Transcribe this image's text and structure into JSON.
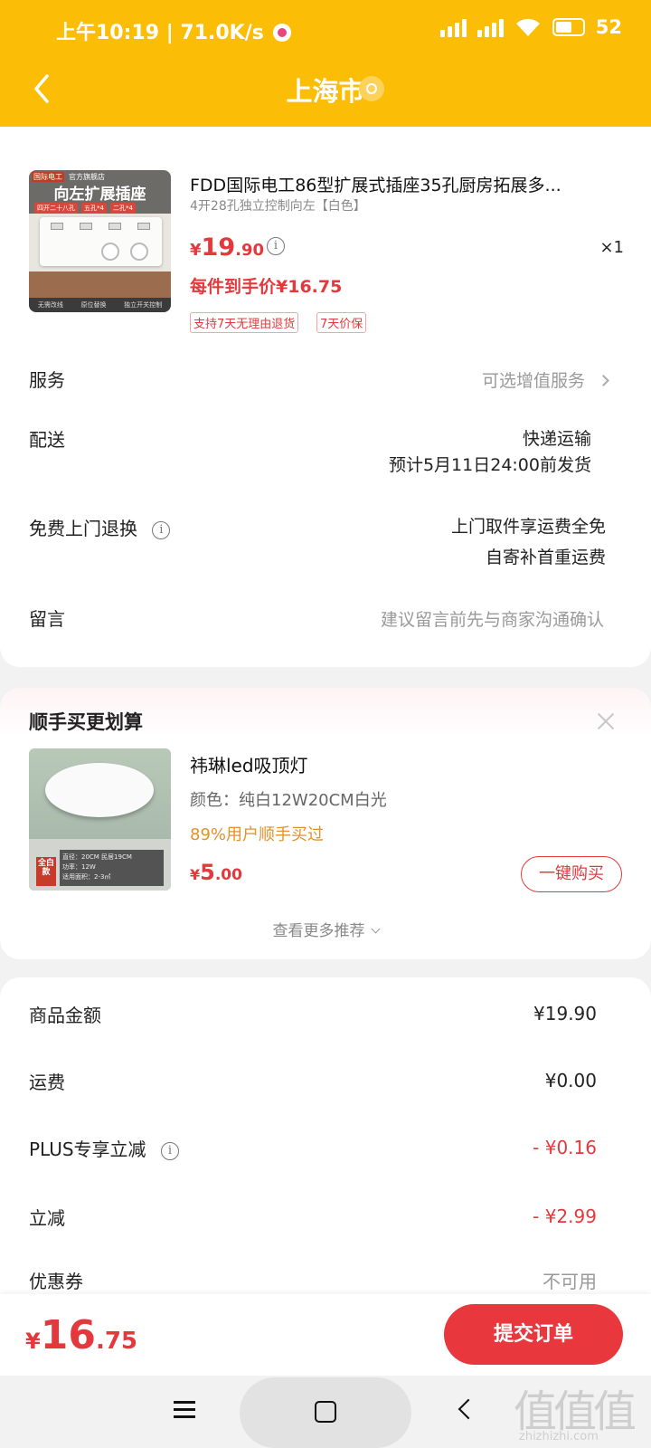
{
  "status_bar": {
    "time": "上午10:19",
    "net_speed": "71.0K/s",
    "battery": "52"
  },
  "nav": {
    "title": "上海市",
    "back_icon": "chevron-left-icon",
    "location_icon": "location-pin-icon"
  },
  "product": {
    "image_labels": {
      "badge1": "国际电工",
      "badge2": "官方旗舰店",
      "headline": "向左扩展插座",
      "chip1": "四开二十八孔",
      "chip2": "五孔*4",
      "chip3": "二孔*4",
      "foot1": "无需改线",
      "foot2": "原位替换",
      "foot3": "独立开关控制"
    },
    "title": "FDD国际电工86型扩展式插座35孔厨房拓展多...",
    "spec": "4开28孔独立控制向左【白色】",
    "price_currency": "¥",
    "price_int": "19",
    "price_dec": ".90",
    "quantity": "×1",
    "hand_price": "每件到手价¥16.75",
    "badges": [
      "支持7天无理由退货",
      "7天价保"
    ]
  },
  "rows": {
    "service_label": "服务",
    "service_value": "可选增值服务",
    "delivery_label": "配送",
    "delivery_value1": "快递运输",
    "delivery_value2": "预计5月11日24:00前发货",
    "return_label": "免费上门退换",
    "return_value1": "上门取件享运费全免",
    "return_value2": "自寄补首重运费",
    "message_label": "留言",
    "message_placeholder": "建议留言前先与商家沟通确认"
  },
  "recommend": {
    "title": "顺手买更划算",
    "image_labels": {
      "badge": "全白款",
      "spec1": "直径：20CM  民居19CM",
      "spec2": "功率：12W",
      "spec3": "适用面积：2-3㎡"
    },
    "item_title": "祎琳led吸顶灯",
    "item_spec": "颜色：纯白12W20CM白光",
    "item_bought": "89%用户顺手买过",
    "price_currency": "¥",
    "price_int": "5",
    "price_dec": ".00",
    "buy_label": "一键购买",
    "more_label": "查看更多推荐"
  },
  "amounts": {
    "goods_label": "商品金额",
    "goods_value": "¥19.90",
    "shipping_label": "运费",
    "shipping_value": "¥0.00",
    "plus_label": "PLUS专享立减",
    "plus_value": "- ¥0.16",
    "discount_label": "立减",
    "discount_value": "- ¥2.99",
    "coupon_label": "优惠券",
    "coupon_value": "不可用"
  },
  "footer": {
    "total_currency": "¥",
    "total_int": "16",
    "total_dec": ".75",
    "submit_label": "提交订单"
  },
  "watermark": {
    "logo": "值值值",
    "site": "zhizhizhi.com"
  },
  "colors": {
    "brand_yellow": "#fbbd05",
    "price_red": "#e4393c",
    "submit_red": "#e8383d",
    "bought_orange": "#e2922c"
  }
}
